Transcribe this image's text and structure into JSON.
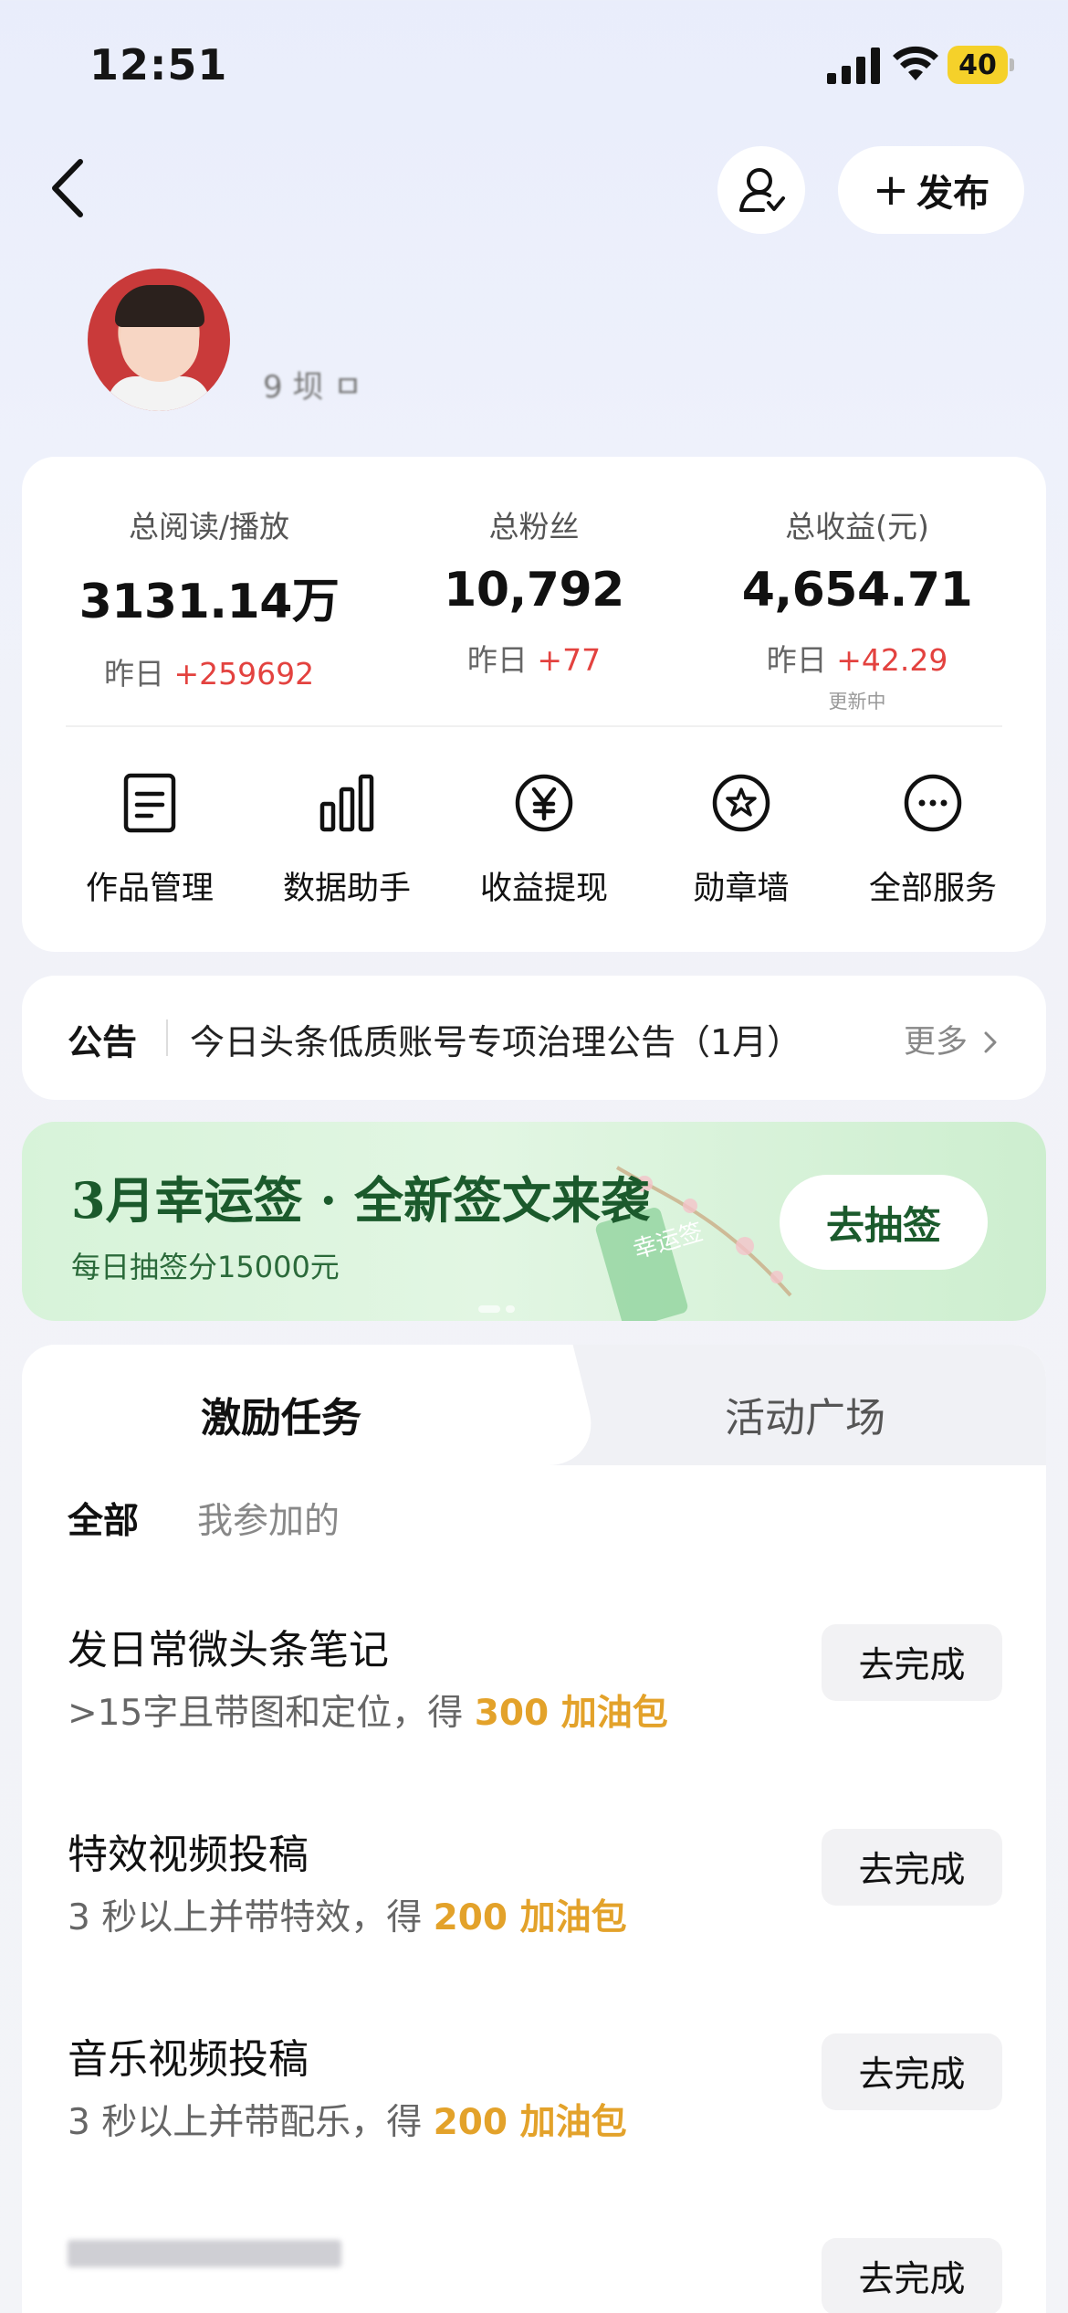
{
  "status": {
    "time": "12:51",
    "battery": "40"
  },
  "nav": {
    "publish_label": "发布"
  },
  "profile": {
    "username": "9 坝 ㅁ"
  },
  "stats": [
    {
      "label": "总阅读/播放",
      "value": "3131.14万",
      "delta_prefix": "昨日 ",
      "delta": "+259692",
      "note": ""
    },
    {
      "label": "总粉丝",
      "value": "10,792",
      "delta_prefix": "昨日 ",
      "delta": "+77",
      "note": ""
    },
    {
      "label": "总收益(元)",
      "value": "4,654.71",
      "delta_prefix": "昨日 ",
      "delta": "+42.29",
      "note": "更新中"
    }
  ],
  "services": [
    {
      "label": "作品管理",
      "icon": "document-icon"
    },
    {
      "label": "数据助手",
      "icon": "bar-chart-icon"
    },
    {
      "label": "收益提现",
      "icon": "yuan-icon"
    },
    {
      "label": "勋章墙",
      "icon": "medal-star-icon"
    },
    {
      "label": "全部服务",
      "icon": "more-dots-icon"
    }
  ],
  "notice": {
    "tag": "公告",
    "text": "今日头条低质账号专项治理公告（1月）",
    "more": "更多"
  },
  "banner": {
    "title": "3月幸运签 · 全新签文来袭",
    "subtitle": "每日抽签分15000元",
    "art_text": "幸运签",
    "button": "去抽签"
  },
  "tabs": {
    "active": "激励任务",
    "other": "活动广场"
  },
  "filters": {
    "all": "全部",
    "mine": "我参加的"
  },
  "tasks": [
    {
      "title": "发日常微头条笔记",
      "desc": ">15字且带图和定位，得 ",
      "reward": "300 加油包",
      "button": "去完成"
    },
    {
      "title": "特效视频投稿",
      "desc": "3 秒以上并带特效，得 ",
      "reward": "200 加油包",
      "button": "去完成"
    },
    {
      "title": "音乐视频投稿",
      "desc": "3 秒以上并带配乐，得 ",
      "reward": "200 加油包",
      "button": "去完成"
    },
    {
      "title": "",
      "desc": "",
      "reward": "",
      "button": "去完成"
    }
  ],
  "colors": {
    "accent_red": "#e3423f",
    "reward_orange": "#e3a22a",
    "banner_green": "#1b5a2c"
  }
}
